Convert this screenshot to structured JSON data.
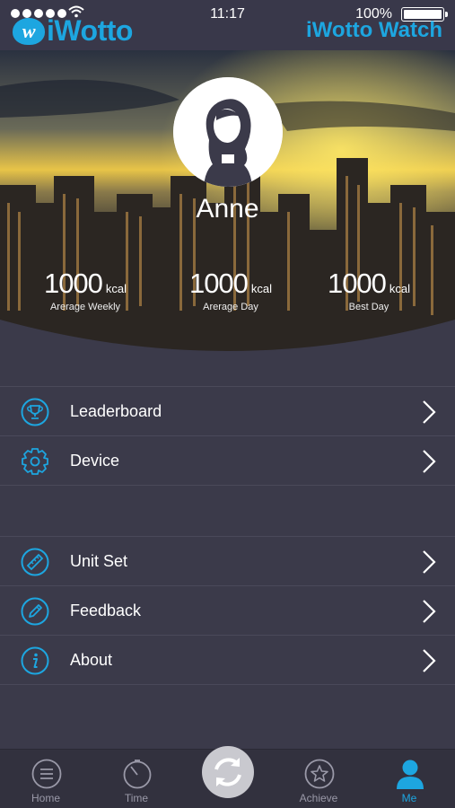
{
  "status_bar": {
    "time": "11:17",
    "battery": "100%"
  },
  "header": {
    "logo_left": "iWotto",
    "logo_left_badge": "w",
    "logo_right": "iWotto Watch"
  },
  "profile": {
    "name": "Anne",
    "stats": [
      {
        "value": "1000",
        "unit": "kcal",
        "label": "Arerage Weekly"
      },
      {
        "value": "1000",
        "unit": "kcal",
        "label": "Arerage Day"
      },
      {
        "value": "1000",
        "unit": "kcal",
        "label": "Best Day"
      }
    ]
  },
  "menu": {
    "group1": [
      {
        "label": "Leaderboard",
        "icon": "trophy-icon"
      },
      {
        "label": "Device",
        "icon": "gear-icon"
      }
    ],
    "group2": [
      {
        "label": "Unit Set",
        "icon": "ruler-icon"
      },
      {
        "label": "Feedback",
        "icon": "pencil-icon"
      },
      {
        "label": "About",
        "icon": "info-icon"
      }
    ]
  },
  "tabbar": {
    "tabs": [
      {
        "label": "Home",
        "icon": "menu-lines-icon"
      },
      {
        "label": "Time",
        "icon": "stopwatch-icon"
      },
      {
        "label": "",
        "icon": "sync-icon"
      },
      {
        "label": "Achieve",
        "icon": "star-icon"
      },
      {
        "label": "Me",
        "icon": "person-icon"
      }
    ],
    "active": "Me"
  },
  "colors": {
    "accent": "#1da6e0",
    "background": "#3b3a4a",
    "tabbar": "#32313e"
  }
}
